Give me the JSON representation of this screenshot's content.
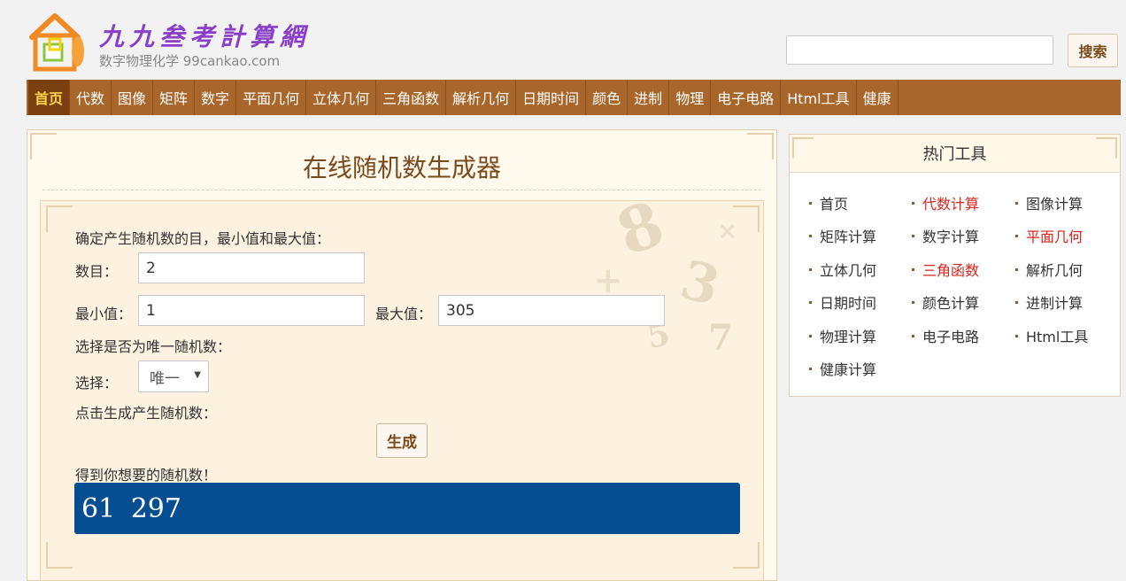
{
  "header": {
    "logo_title": "九九叁考計算網",
    "logo_subtitle": "数字物理化学 99cankao.com",
    "search_placeholder": "",
    "search_button": "搜索"
  },
  "nav": {
    "items": [
      "首页",
      "代数",
      "图像",
      "矩阵",
      "数字",
      "平面几何",
      "立体几何",
      "三角函数",
      "解析几何",
      "日期时间",
      "颜色",
      "进制",
      "物理",
      "电子电路",
      "Html工具",
      "健康"
    ],
    "active_index": 0
  },
  "main": {
    "title": "在线随机数生成器",
    "instruction": "确定产生随机数的目，最小值和最大值：",
    "count_label": "数目：",
    "count_value": "2",
    "min_label": "最小值：",
    "min_value": "1",
    "max_label": "最大值：",
    "max_value": "305",
    "unique_prompt": "选择是否为唯一随机数：",
    "select_label": "选择：",
    "select_value": "唯一",
    "generate_prompt": "点击生成产生随机数：",
    "generate_button": "生成",
    "result_label": "得到你想要的随机数！",
    "result_value": "61  297"
  },
  "side": {
    "title": "热门工具",
    "tools": [
      {
        "label": "首页",
        "highlight": false
      },
      {
        "label": "代数计算",
        "highlight": true
      },
      {
        "label": "图像计算",
        "highlight": false
      },
      {
        "label": "矩阵计算",
        "highlight": false
      },
      {
        "label": "数字计算",
        "highlight": false
      },
      {
        "label": "平面几何",
        "highlight": true
      },
      {
        "label": "立体几何",
        "highlight": false
      },
      {
        "label": "三角函数",
        "highlight": true
      },
      {
        "label": "解析几何",
        "highlight": false
      },
      {
        "label": "日期时间",
        "highlight": false
      },
      {
        "label": "颜色计算",
        "highlight": false
      },
      {
        "label": "进制计算",
        "highlight": false
      },
      {
        "label": "物理计算",
        "highlight": false
      },
      {
        "label": "电子电路",
        "highlight": false
      },
      {
        "label": "Html工具",
        "highlight": false
      },
      {
        "label": "健康计算",
        "highlight": false
      }
    ]
  },
  "colors": {
    "nav_bg": "#a9662a",
    "nav_active_bg": "#7a4010",
    "nav_active_text": "#ffd34a",
    "result_bg": "#064e92",
    "highlight_link": "#d9251c"
  }
}
